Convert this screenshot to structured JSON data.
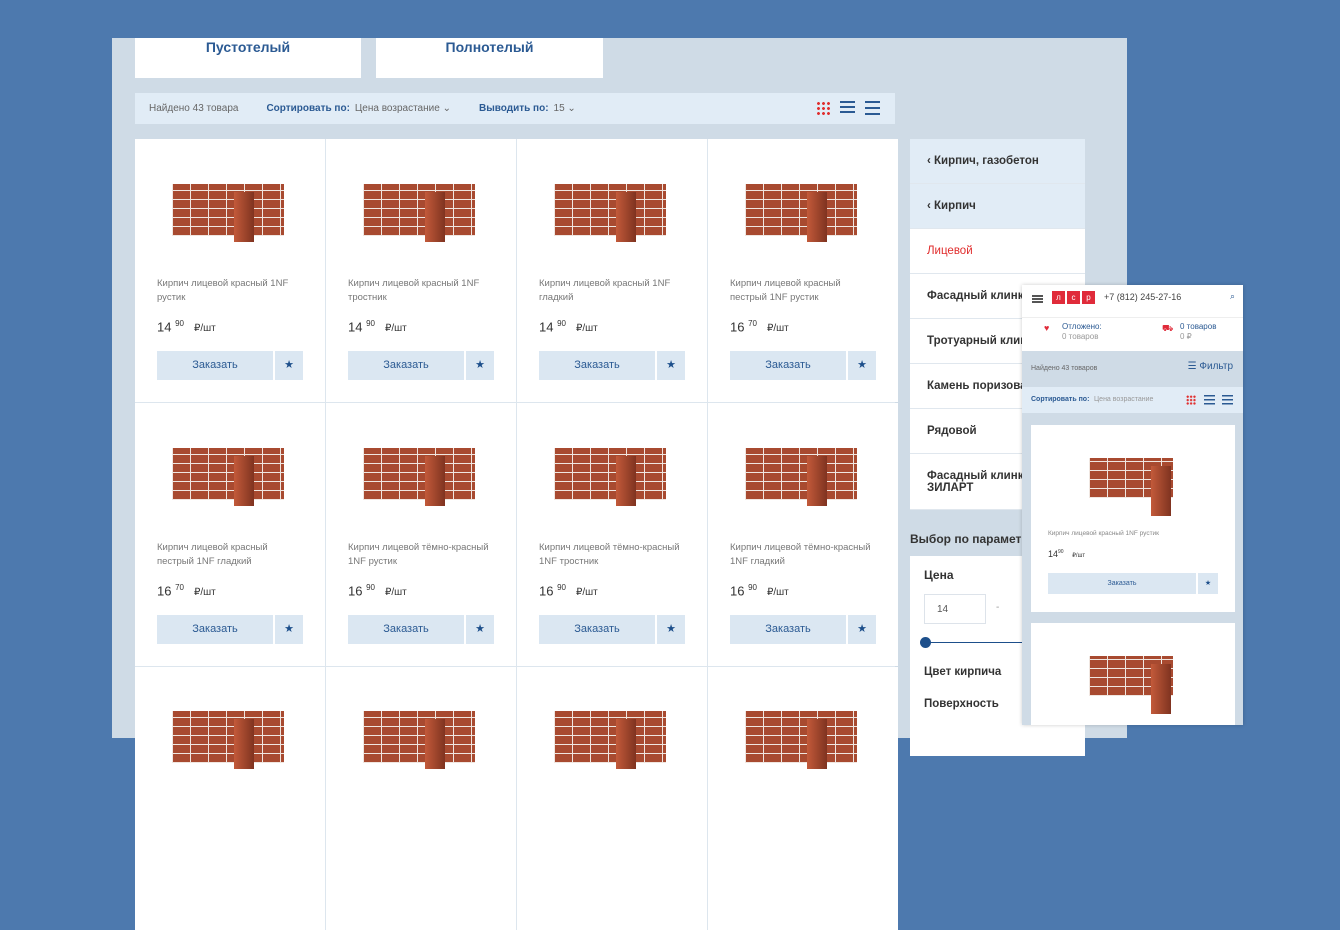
{
  "categories": [
    "Пустотелый",
    "Полнотелый"
  ],
  "toolbar": {
    "found": "Найдено 43 товара",
    "sort_label": "Сортировать по:",
    "sort_value": "Цена возрастание",
    "perpage_label": "Выводить по:",
    "perpage_value": "15"
  },
  "products": [
    {
      "name": "Кирпич лицевой красный 1NF рустик",
      "price": "14",
      "kop": "90"
    },
    {
      "name": "Кирпич лицевой красный 1NF тростник",
      "price": "14",
      "kop": "90"
    },
    {
      "name": "Кирпич лицевой красный 1NF гладкий",
      "price": "14",
      "kop": "90"
    },
    {
      "name": "Кирпич лицевой красный пестрый 1NF рустик",
      "price": "16",
      "kop": "70"
    },
    {
      "name": "Кирпич лицевой красный пестрый 1NF гладкий",
      "price": "16",
      "kop": "70"
    },
    {
      "name": "Кирпич лицевой тёмно-красный 1NF рустик",
      "price": "16",
      "kop": "90"
    },
    {
      "name": "Кирпич лицевой тёмно-красный 1NF тростник",
      "price": "16",
      "kop": "90"
    },
    {
      "name": "Кирпич лицевой тёмно-красный 1NF гладкий",
      "price": "16",
      "kop": "90"
    }
  ],
  "unit": "₽/шт",
  "order_label": "Заказать",
  "star": "★",
  "sidebar": {
    "items": [
      "‹  Кирпич, газобетон",
      "‹  Кирпич",
      "Лицевой",
      "Фасадный клинкер",
      "Тротуарный клинкер",
      "Камень поризованный",
      "Рядовой",
      "Фасадный клинкер ЗИЛАРТ"
    ],
    "filter_title": "Выбор по параметрам",
    "price_label": "Цена",
    "price_from": "14",
    "dash": "-",
    "color_label": "Цвет кирпича",
    "surface_label": "Поверхность"
  },
  "mobile": {
    "logo": [
      "л",
      "с",
      "р"
    ],
    "phone": "+7 (812) 245-27-16",
    "deferred_label": "Отложено:",
    "deferred_value": "0 товаров",
    "cart_label": "0 товаров",
    "cart_value": "0 ₽",
    "found": "Найдено 43 товаров",
    "filter": "Фильтр",
    "sort_label": "Сортировать по:",
    "sort_value": "Цена возрастание",
    "product_name": "Кирпич лицевой красный 1NF рустик",
    "price": "14",
    "kop": "90",
    "unit": "₽/шт",
    "order": "Заказать"
  }
}
